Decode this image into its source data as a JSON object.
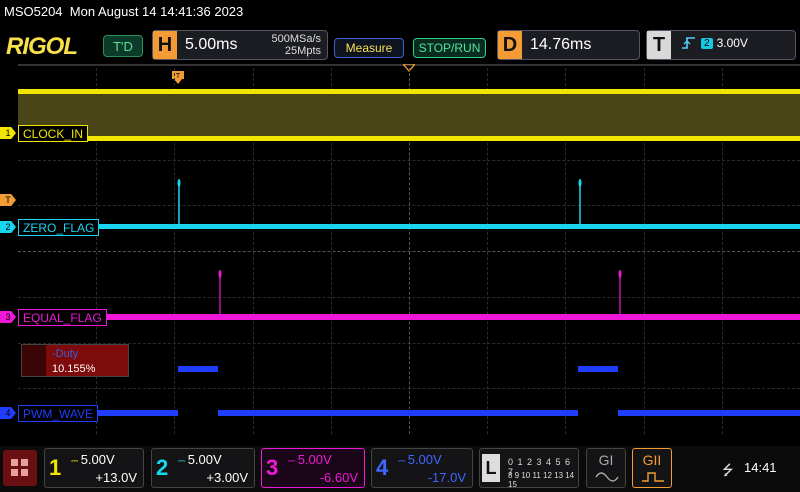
{
  "title_bar": {
    "model": "MSO5204",
    "datetime": "Mon August 14 14:41:36 2023"
  },
  "logo": "RIGOL",
  "trigger_status": "T'D",
  "horizontal": {
    "letter": "H",
    "timebase": "5.00ms",
    "sample_rate": "500MSa/s",
    "memory_depth": "25Mpts"
  },
  "buttons": {
    "measure": "Measure",
    "stop_run": "STOP/RUN"
  },
  "delay": {
    "letter": "D",
    "value": "14.76ms"
  },
  "trigger": {
    "letter": "T",
    "slope_icon": "rising-edge-icon",
    "source": "2",
    "level": "3.00V"
  },
  "channels": [
    {
      "num": "1",
      "label": "CLOCK_IN",
      "scale": "5.00V",
      "offset": "+13.0V",
      "color": "#f2e600"
    },
    {
      "num": "2",
      "label": "ZERO_FLAG",
      "scale": "5.00V",
      "offset": "+3.00V",
      "color": "#18d6f0"
    },
    {
      "num": "3",
      "label": "EQUAL_FLAG",
      "scale": "5.00V",
      "offset": "-6.60V",
      "color": "#f018d8"
    },
    {
      "num": "4",
      "label": "PWM_WAVE",
      "scale": "5.00V",
      "offset": "-17.0V",
      "color": "#1f3cff"
    }
  ],
  "trigger_marker": "T",
  "measurement": {
    "name": "-Duty",
    "value": "10.155%"
  },
  "logic": {
    "letter": "L",
    "row1": "0 1 2 3 4 5 6 7",
    "row2": "8 9 10 11 12 13 14 15"
  },
  "generators": [
    {
      "label": "GI"
    },
    {
      "label": "GII"
    }
  ],
  "status": {
    "usb_icon": "usb-icon",
    "time": "14:41"
  }
}
